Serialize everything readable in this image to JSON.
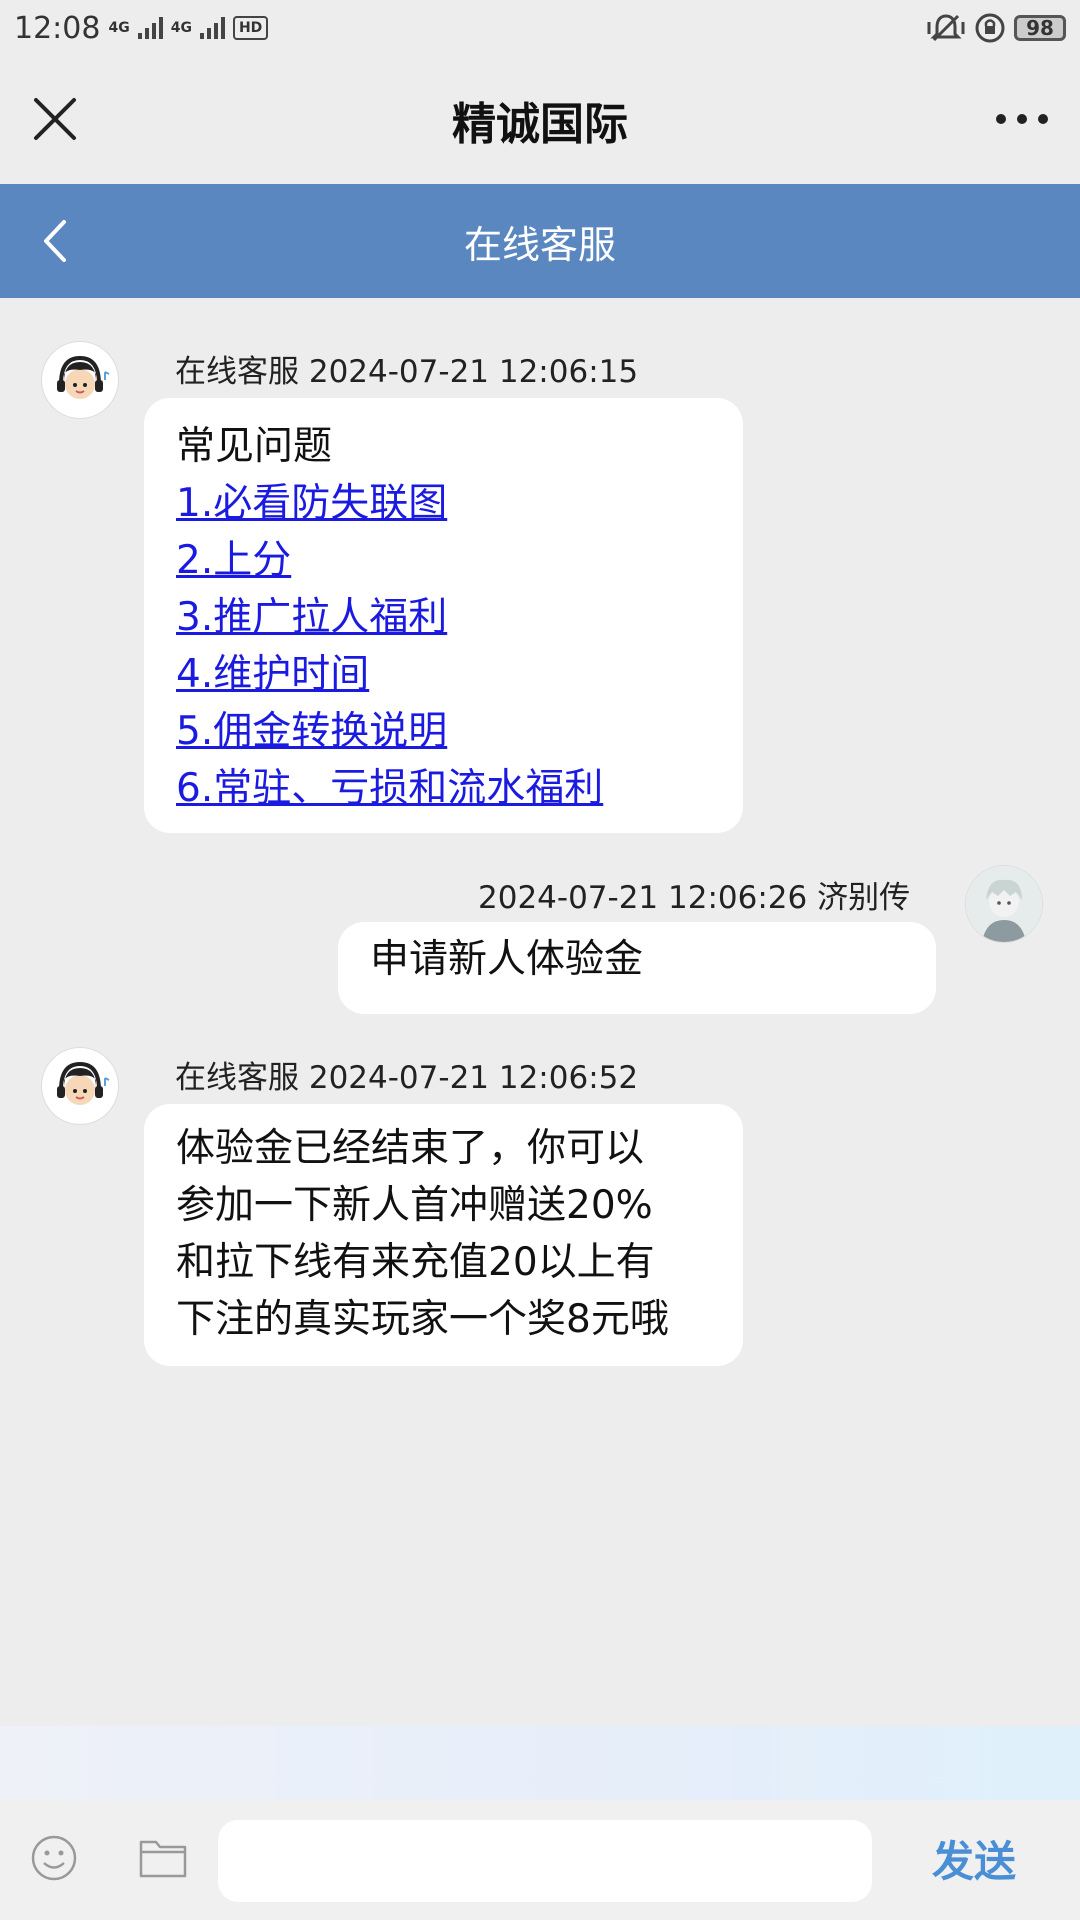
{
  "status_bar": {
    "time": "12:08",
    "network1": "4G",
    "network2": "4G",
    "hd": "HD",
    "battery": "98"
  },
  "titlebar": {
    "title": "精诚国际"
  },
  "header": {
    "title": "在线客服"
  },
  "messages": [
    {
      "side": "left",
      "meta": "在线客服 2024-07-21 12:06:15",
      "heading": "常见问题",
      "links": [
        "1.必看防失联图",
        "2.上分",
        "3.推广拉人福利",
        "4.维护时间",
        "5.佣金转换说明",
        "6.常驻、亏损和流水福利"
      ]
    },
    {
      "side": "right",
      "meta": "2024-07-21 12:06:26 济别传",
      "text": "申请新人体验金"
    },
    {
      "side": "left",
      "meta": "在线客服 2024-07-21 12:06:52",
      "lines": [
        "体验金已经结束了，你可以",
        "参加一下新人首冲赠送20%",
        "和拉下线有来充值20以上有",
        "下注的真实玩家一个奖8元哦"
      ]
    }
  ],
  "input": {
    "placeholder": "",
    "send_label": "发送"
  },
  "colors": {
    "header_bg": "#5a87c0",
    "link": "#1a1ae0",
    "send": "#4a8fd6"
  }
}
